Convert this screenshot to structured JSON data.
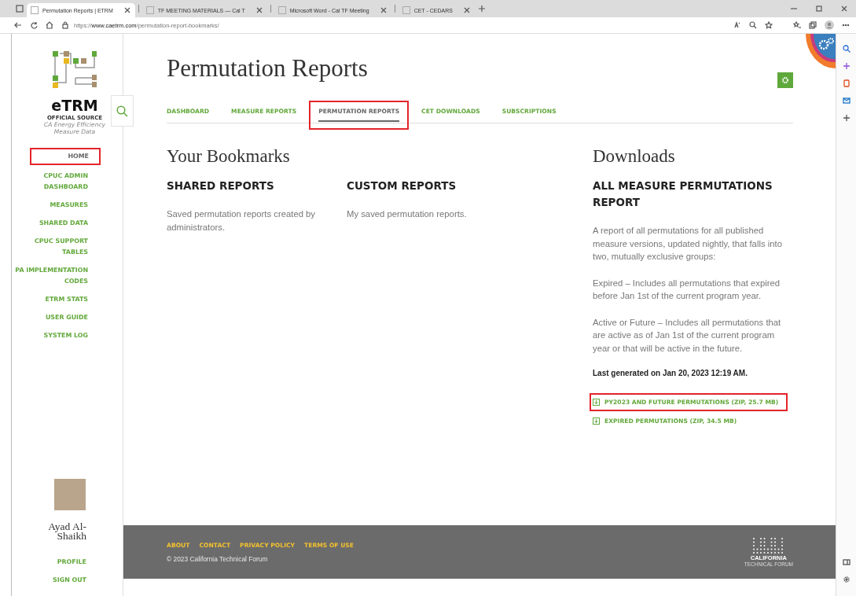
{
  "browser": {
    "tabs": [
      {
        "title": "Permutation Reports | ETRM",
        "selected": true
      },
      {
        "title": "TF MEETING MATERIALS — Cal T",
        "selected": false
      },
      {
        "title": "Microsoft Word - Cal TF Meeting",
        "selected": false
      },
      {
        "title": "CET - CEDARS",
        "selected": false
      }
    ],
    "url": "https://**www.caetrm.com**/permutation-report-bookmarks/"
  },
  "sidebar": {
    "logo": {
      "name": "eTRM",
      "tagline": "OFFICIAL SOURCE",
      "subtitle": "CA Energy Efficiency Measure Data"
    },
    "nav": [
      {
        "label": "HOME",
        "selected": true,
        "highlighted": true
      },
      {
        "label": "CPUC ADMIN DASHBOARD",
        "selected": false,
        "highlighted": false
      },
      {
        "label": "MEASURES",
        "selected": false,
        "highlighted": false
      },
      {
        "label": "SHARED DATA",
        "selected": false,
        "highlighted": false
      },
      {
        "label": "CPUC SUPPORT TABLES",
        "selected": false,
        "highlighted": false
      },
      {
        "label": "PA IMPLEMENTATION CODES",
        "selected": false,
        "highlighted": false
      },
      {
        "label": "ETRM STATS",
        "selected": false,
        "highlighted": false
      },
      {
        "label": "USER GUIDE",
        "selected": false,
        "highlighted": false
      },
      {
        "label": "SYSTEM LOG",
        "selected": false,
        "highlighted": false
      }
    ],
    "user": {
      "name": "Ayad Al-Shaikh",
      "links": [
        "PROFILE",
        "SIGN OUT"
      ]
    }
  },
  "page": {
    "title": "Permutation Reports",
    "tabs": [
      {
        "label": "DASHBOARD",
        "selected": false,
        "highlighted": false
      },
      {
        "label": "MEASURE REPORTS",
        "selected": false,
        "highlighted": false
      },
      {
        "label": "PERMUTATION REPORTS",
        "selected": true,
        "highlighted": true
      },
      {
        "label": "CET DOWNLOADS",
        "selected": false,
        "highlighted": false
      },
      {
        "label": "SUBSCRIPTIONS",
        "selected": false,
        "highlighted": false
      }
    ],
    "bookmarks": {
      "heading": "Your Bookmarks",
      "sections": [
        {
          "title": "SHARED REPORTS",
          "text": "Saved permutation reports created by administrators."
        },
        {
          "title": "CUSTOM REPORTS",
          "text": "My saved permutation reports."
        }
      ]
    },
    "downloads": {
      "heading": "Downloads",
      "title": "ALL MEASURE PERMUTATIONS REPORT",
      "paragraphs": [
        "A report of all permutations for all published measure versions, updated nightly, that falls into two, mutually exclusive groups:",
        "Expired – Includes all permutations that expired before Jan 1st of the current program year.",
        "Active or Future – Includes all permutations that are active as of Jan 1st of the current program year or that will be active in the future."
      ],
      "generated": "Last generated on Jan 20, 2023 12:19 AM.",
      "links": [
        {
          "label": "PY2023 AND FUTURE PERMUTATIONS (ZIP, 25.7 MB)",
          "highlighted": true
        },
        {
          "label": "EXPIRED PERMUTATIONS (ZIP, 34.5 MB)",
          "highlighted": false
        }
      ]
    }
  },
  "footer": {
    "links": [
      "ABOUT",
      "CONTACT",
      "PRIVACY POLICY",
      "TERMS OF USE"
    ],
    "copyright": "© 2023 California Technical Forum",
    "logo": {
      "name": "CALIFORNIA",
      "subtitle": "TECHNICAL FORUM"
    }
  }
}
